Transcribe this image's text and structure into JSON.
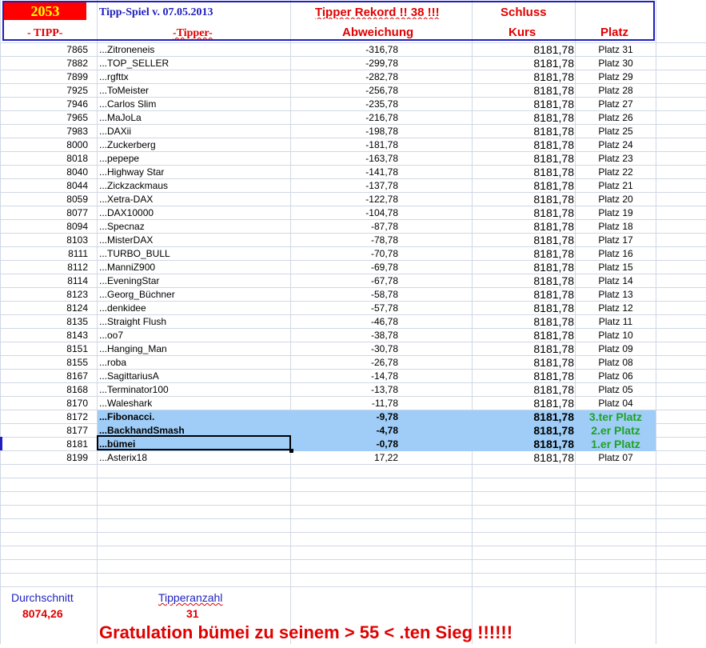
{
  "header": {
    "year": "2053",
    "title": "Tipp-Spiel v. 07.05.2013",
    "rekord": "Tipper Rekord !!  38  !!!",
    "schluss": "Schluss"
  },
  "columns": {
    "tipp": "- TIPP-",
    "tipper": "-Tipper-",
    "abweichung": "Abweichung",
    "kurs": "Kurs",
    "platz": "Platz"
  },
  "rows": [
    {
      "tipp": "7865",
      "name": "...Zitroneneis",
      "abw": "-316,78",
      "kurs": "8181,78",
      "platz": "Platz 31"
    },
    {
      "tipp": "7882",
      "name": "...TOP_SELLER",
      "abw": "-299,78",
      "kurs": "8181,78",
      "platz": "Platz 30"
    },
    {
      "tipp": "7899",
      "name": "...rgfttx",
      "abw": "-282,78",
      "kurs": "8181,78",
      "platz": "Platz 29"
    },
    {
      "tipp": "7925",
      "name": "...ToMeister",
      "abw": "-256,78",
      "kurs": "8181,78",
      "platz": "Platz 28"
    },
    {
      "tipp": "7946",
      "name": "...Carlos Slim",
      "abw": "-235,78",
      "kurs": "8181,78",
      "platz": "Platz 27"
    },
    {
      "tipp": "7965",
      "name": "...MaJoLa",
      "abw": "-216,78",
      "kurs": "8181,78",
      "platz": "Platz 26"
    },
    {
      "tipp": "7983",
      "name": "...DAXii",
      "abw": "-198,78",
      "kurs": "8181,78",
      "platz": "Platz 25"
    },
    {
      "tipp": "8000",
      "name": "...Zuckerberg",
      "abw": "-181,78",
      "kurs": "8181,78",
      "platz": "Platz 24"
    },
    {
      "tipp": "8018",
      "name": "...pepepe",
      "abw": "-163,78",
      "kurs": "8181,78",
      "platz": "Platz 23"
    },
    {
      "tipp": "8040",
      "name": "...Highway Star",
      "abw": "-141,78",
      "kurs": "8181,78",
      "platz": "Platz 22"
    },
    {
      "tipp": "8044",
      "name": "...Zickzackmaus",
      "abw": "-137,78",
      "kurs": "8181,78",
      "platz": "Platz 21"
    },
    {
      "tipp": "8059",
      "name": "...Xetra-DAX",
      "abw": "-122,78",
      "kurs": "8181,78",
      "platz": "Platz 20"
    },
    {
      "tipp": "8077",
      "name": "...DAX10000",
      "abw": "-104,78",
      "kurs": "8181,78",
      "platz": "Platz 19"
    },
    {
      "tipp": "8094",
      "name": "...Specnaz",
      "abw": "-87,78",
      "kurs": "8181,78",
      "platz": "Platz 18"
    },
    {
      "tipp": "8103",
      "name": "...MisterDAX",
      "abw": "-78,78",
      "kurs": "8181,78",
      "platz": "Platz 17"
    },
    {
      "tipp": "8111",
      "name": "...TURBO_BULL",
      "abw": "-70,78",
      "kurs": "8181,78",
      "platz": "Platz 16"
    },
    {
      "tipp": "8112",
      "name": "...ManniZ900",
      "abw": "-69,78",
      "kurs": "8181,78",
      "platz": "Platz 15"
    },
    {
      "tipp": "8114",
      "name": "...EveningStar",
      "abw": "-67,78",
      "kurs": "8181,78",
      "platz": "Platz 14"
    },
    {
      "tipp": "8123",
      "name": "...Georg_Büchner",
      "abw": "-58,78",
      "kurs": "8181,78",
      "platz": "Platz 13"
    },
    {
      "tipp": "8124",
      "name": "...denkidee",
      "abw": "-57,78",
      "kurs": "8181,78",
      "platz": "Platz 12"
    },
    {
      "tipp": "8135",
      "name": "...Straight Flush",
      "abw": "-46,78",
      "kurs": "8181,78",
      "platz": "Platz 11"
    },
    {
      "tipp": "8143",
      "name": "...oo7",
      "abw": "-38,78",
      "kurs": "8181,78",
      "platz": "Platz 10"
    },
    {
      "tipp": "8151",
      "name": "...Hanging_Man",
      "abw": "-30,78",
      "kurs": "8181,78",
      "platz": "Platz 09"
    },
    {
      "tipp": "8155",
      "name": "...roba",
      "abw": "-26,78",
      "kurs": "8181,78",
      "platz": "Platz 08"
    },
    {
      "tipp": "8167",
      "name": "...SagittariusA",
      "abw": "-14,78",
      "kurs": "8181,78",
      "platz": "Platz 06"
    },
    {
      "tipp": "8168",
      "name": "...Terminator100",
      "abw": "-13,78",
      "kurs": "8181,78",
      "platz": "Platz 05"
    },
    {
      "tipp": "8170",
      "name": "...Waleshark",
      "abw": "-11,78",
      "kurs": "8181,78",
      "platz": "Platz 04"
    },
    {
      "tipp": "8172",
      "name": "...Fibonacci.",
      "abw": "-9,78",
      "kurs": "8181,78",
      "platz": "3.ter Platz",
      "highlight": true
    },
    {
      "tipp": "8177",
      "name": "...BackhandSmash",
      "abw": "-4,78",
      "kurs": "8181,78",
      "platz": "2.er Platz",
      "highlight": true
    },
    {
      "tipp": "8181",
      "name": "...bümei",
      "abw": "-0,78",
      "kurs": "8181,78",
      "platz": "1.er Platz",
      "highlight": true
    },
    {
      "tipp": "8199",
      "name": "...Asterix18",
      "abw": "17,22",
      "kurs": "8181,78",
      "platz": "Platz 07"
    }
  ],
  "footer": {
    "avg_label": "Durchschnitt",
    "avg_value": "8074,26",
    "count_label": "Tipperanzahl",
    "count_value": "31",
    "gratulation": "Gratulation   bümei   zu seinem > 55 < .ten Sieg !!!!!!"
  },
  "colors": {
    "highlight": "#9fcdf7",
    "header_red": "#e00000",
    "header_blue": "#1f1fbf",
    "winner_green": "#1fa31f",
    "year_bg": "#ff0000",
    "year_fg": "#ffff00"
  }
}
